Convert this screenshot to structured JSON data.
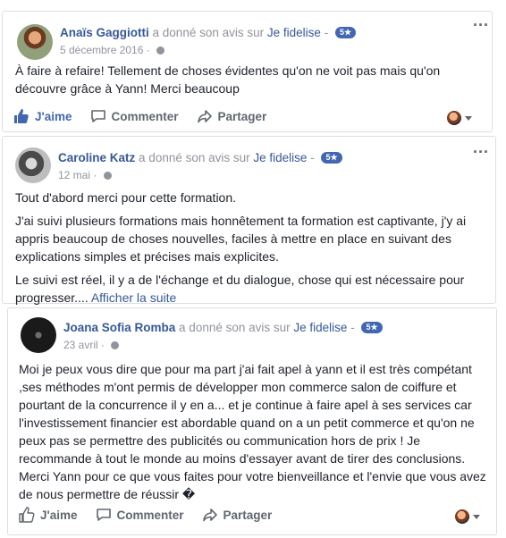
{
  "reviews": [
    {
      "author": "Anaïs Gaggiotti",
      "action_text": "a donné son avis sur",
      "page": "Je fidelise",
      "separator": "-",
      "rating": "5★",
      "date": "5 décembre 2016",
      "dot": "·",
      "paragraphs": [
        "À faire à refaire! Tellement de choses évidentes qu'on ne voit pas mais qu'on découvre grâce à Yann! Merci beaucoup"
      ],
      "see_more": "",
      "like_label": "J'aime",
      "comment_label": "Commenter",
      "share_label": "Partager",
      "liked": true,
      "more_icon": "ellipsis-icon"
    },
    {
      "author": "Caroline Katz",
      "action_text": "a donné son avis sur",
      "page": "Je fidelise",
      "separator": "-",
      "rating": "5★",
      "date": "12 mai",
      "dot": "·",
      "paragraphs": [
        "Tout d'abord merci pour cette formation.",
        "J'ai suivi plusieurs formations mais honnêtement ta formation est captivante, j'y ai appris beaucoup de choses nouvelles, faciles à mettre en place en suivant des explications simples et précises mais explicites.",
        "Le suivi est réel, il y a de l'échange et du dialogue, chose qui est nécessaire pour progresser...."
      ],
      "see_more": "Afficher la suite",
      "more_icon": "ellipsis-icon"
    },
    {
      "author": "Joana Sofia Romba",
      "action_text": "a donné son avis sur",
      "page": "Je fidelise",
      "separator": "-",
      "rating": "5★",
      "date": "23 avril",
      "dot": "·",
      "paragraphs": [
        "Moi je peux vous dire que pour ma part j'ai fait apel à yann et il est très compétant ,ses méthodes m'ont permis de développer mon commerce salon de coiffure et pourtant de la concurrence il y en a... et je continue à faire apel à ses services car l'investissement financier est abordable quand on a un petit commerce et qu'on ne peux pas se permettre des publicités ou communication hors de prix ! Je recommande à tout le monde au moins d'essayer avant de tirer des conclusions. Merci Yann pour ce que vous faites pour votre bienveillance et l'envie que vous avez de nous permettre de réussir �"
      ],
      "see_more": "",
      "like_label": "J'aime",
      "comment_label": "Commenter",
      "share_label": "Partager",
      "liked": false,
      "more_icon": "ellipsis-icon"
    }
  ],
  "colors": {
    "link": "#365899",
    "badge": "#4267b2",
    "muted": "#90949c",
    "text": "#1d2129",
    "border": "#dddfe2"
  }
}
